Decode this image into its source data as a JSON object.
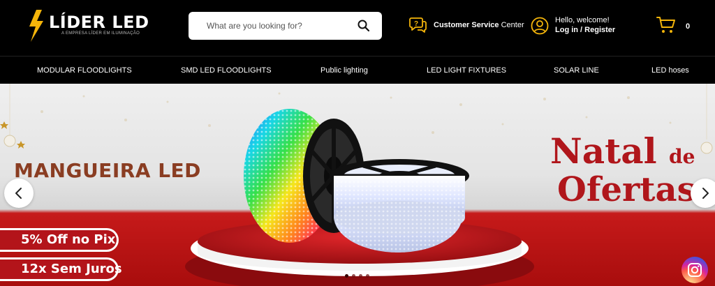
{
  "brand": {
    "name": "LÍDER LED",
    "tagline": "A EMPRESA LÍDER EM ILUMINAÇÃO"
  },
  "search": {
    "placeholder": "What are you looking for?",
    "value": ""
  },
  "customer_service": {
    "bold": "Customer Service",
    "rest": "Center"
  },
  "account": {
    "greeting": "Hello, welcome!",
    "login_label": "Log in / Register"
  },
  "cart": {
    "count": "0"
  },
  "nav": {
    "items": [
      {
        "label": "MODULAR FLOODLIGHTS"
      },
      {
        "label": "SMD LED FLOODLIGHTS"
      },
      {
        "label": "Public lighting"
      },
      {
        "label": "LED LIGHT FIXTURES"
      },
      {
        "label": "SOLAR LINE"
      },
      {
        "label": "LED hoses"
      }
    ]
  },
  "banner": {
    "headline": "MANGUEIRA LED",
    "natal": "Natal",
    "de": "de",
    "ofertas": "Ofertas",
    "pill_pix": "5% Off no Pix",
    "pill_juros": "12x Sem Juros",
    "active_slide": 1,
    "slide_count": 4
  },
  "colors": {
    "accent": "#f5b50a",
    "promo_red": "#b3141a",
    "headline_brown": "#8a3d22"
  },
  "icons": {
    "logo": "lightning-bolt-icon",
    "search": "search-icon",
    "customer_service": "chat-question-icon",
    "account": "user-circle-icon",
    "cart": "cart-icon",
    "prev": "chevron-left-icon",
    "next": "chevron-right-icon",
    "social": "instagram-icon"
  }
}
